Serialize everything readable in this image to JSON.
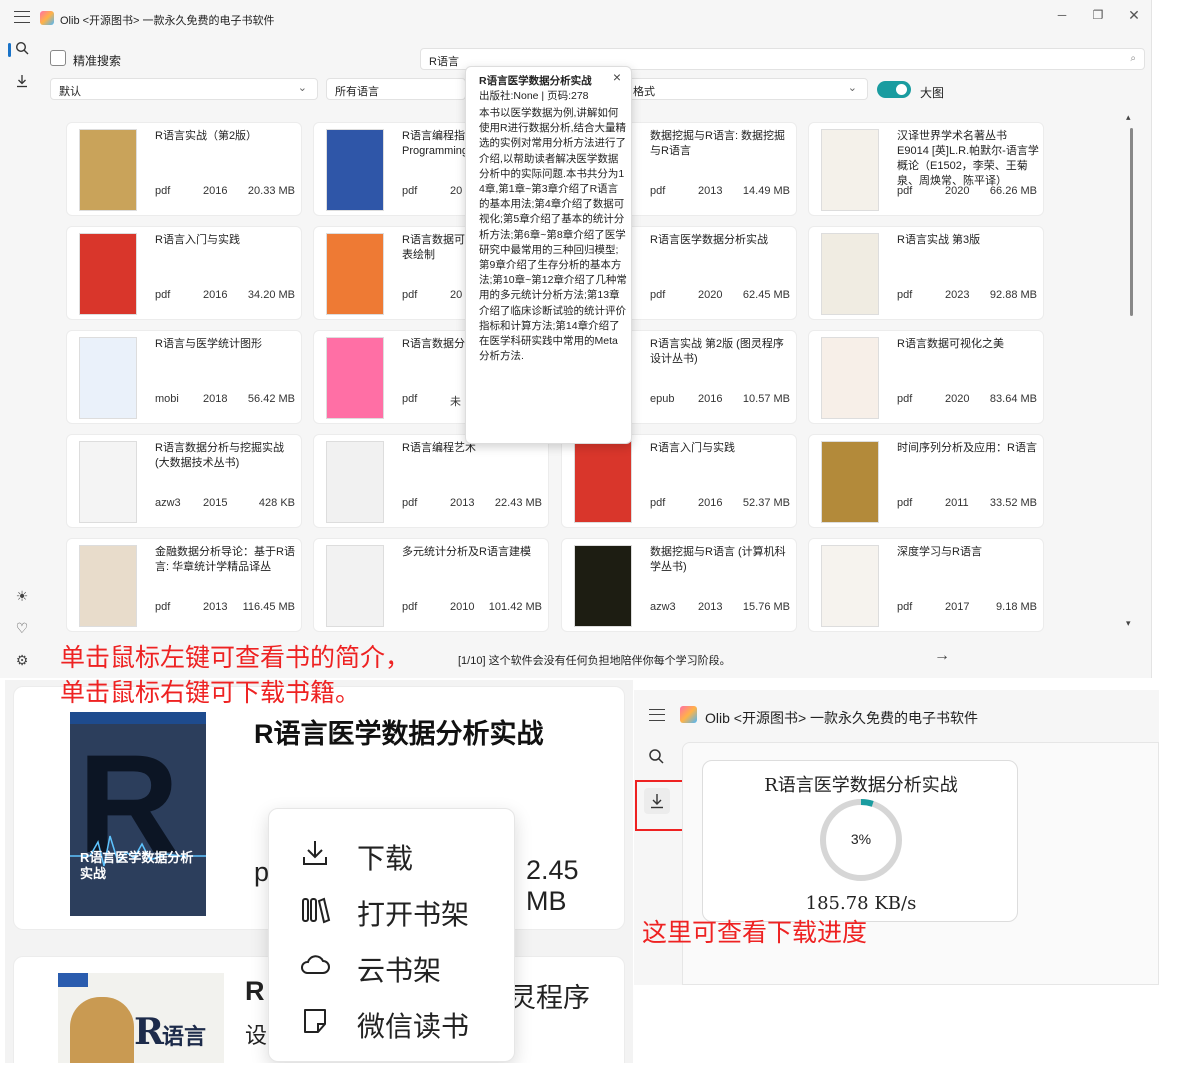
{
  "app": {
    "title": "Olib <开源图书> 一款永久免费的电子书软件",
    "window_controls": [
      "minimize",
      "maximize",
      "close"
    ]
  },
  "sidebar": {
    "top_icons": [
      "search-icon",
      "download-icon"
    ],
    "bottom_icons": [
      "theme-icon",
      "heart-icon",
      "settings-icon"
    ]
  },
  "search": {
    "exact_label": "精准搜索",
    "exact_checked": false,
    "query": "R语言"
  },
  "filters": {
    "sort": "默认",
    "language": "所有语言",
    "format": "格式",
    "large_image_label": "大图",
    "large_image_on": true
  },
  "books": [
    {
      "title": "R语言实战（第2版）",
      "format": "pdf",
      "year": "2016",
      "size": "20.33 MB",
      "cover": "#c9a35a"
    },
    {
      "title": "R语言编程指南 Programming",
      "format": "pdf",
      "year": "20",
      "size": "",
      "cover": "#2f56a8"
    },
    {
      "title": "",
      "format": "",
      "year": "",
      "size": "",
      "cover": "#ffffff"
    },
    {
      "title": "数据挖掘与R语言: 数据挖掘与R语言",
      "format": "pdf",
      "year": "2013",
      "size": "14.49 MB",
      "cover": "#ffffff"
    },
    {
      "title": "汉译世界学术名著丛书 E9014 [英]L.R.帕默尔-语言学概论（E1502，李荣、王菊泉、周焕常、陈平译）",
      "format": "pdf",
      "year": "2020",
      "size": "66.26 MB",
      "cover": "#f4f1ea"
    },
    {
      "title": "R语言入门与实践",
      "format": "pdf",
      "year": "2016",
      "size": "34.20 MB",
      "cover": "#d9362b"
    },
    {
      "title": "R语言数据可视化之美 业图表绘制",
      "format": "pdf",
      "year": "20",
      "size": "",
      "cover": "#ee7a34"
    },
    {
      "title": "",
      "format": "",
      "year": "",
      "size": "",
      "cover": "#ffffff"
    },
    {
      "title": "R语言医学数据分析实战",
      "format": "pdf",
      "year": "2020",
      "size": "62.45 MB",
      "cover": "#ffffff"
    },
    {
      "title": "R语言实战 第3版",
      "format": "pdf",
      "year": "2023",
      "size": "92.88 MB",
      "cover": "#f0ece2"
    },
    {
      "title": "R语言与医学统计图形",
      "format": "mobi",
      "year": "2018",
      "size": "56.42 MB",
      "cover": "#eaf1fa"
    },
    {
      "title": "R语言数据分",
      "format": "pdf",
      "year": "未",
      "size": "",
      "cover": "#ff6fa5"
    },
    {
      "title": "",
      "format": "",
      "year": "",
      "size": "",
      "cover": "#ffffff"
    },
    {
      "title": "R语言实战 第2版 (图灵程序设计丛书)",
      "format": "epub",
      "year": "2016",
      "size": "10.57 MB",
      "cover": "#ffffff"
    },
    {
      "title": "R语言数据可视化之美",
      "format": "pdf",
      "year": "2020",
      "size": "83.64 MB",
      "cover": "#f7efe8"
    },
    {
      "title": "R语言数据分析与挖掘实战 (大数据技术丛书)",
      "format": "azw3",
      "year": "2015",
      "size": "428 KB",
      "cover": "#f4f4f4"
    },
    {
      "title": "R语言编程艺术",
      "format": "pdf",
      "year": "2013",
      "size": "22.43 MB",
      "cover": "#f1f1f1"
    },
    {
      "title": "",
      "format": "",
      "year": "",
      "size": "",
      "cover": "#ffffff"
    },
    {
      "title": "R语言入门与实践",
      "format": "pdf",
      "year": "2016",
      "size": "52.37 MB",
      "cover": "#d9362b"
    },
    {
      "title": "时间序列分析及应用：R语言",
      "format": "pdf",
      "year": "2011",
      "size": "33.52 MB",
      "cover": "#b38a3a"
    },
    {
      "title": "金融数据分析导论：基于R语言: 华章统计学精品译丛",
      "format": "pdf",
      "year": "2013",
      "size": "116.45 MB",
      "cover": "#e8dccb"
    },
    {
      "title": "多元统计分析及R语言建模",
      "format": "pdf",
      "year": "2010",
      "size": "101.42 MB",
      "cover": "#f2f2f2"
    },
    {
      "title": "",
      "format": "",
      "year": "",
      "size": "",
      "cover": "#ffffff"
    },
    {
      "title": "数据挖掘与R语言 (计算机科学丛书)",
      "format": "azw3",
      "year": "2013",
      "size": "15.76 MB",
      "cover": "#1d1d12"
    },
    {
      "title": "深度学习与R语言",
      "format": "pdf",
      "year": "2017",
      "size": "9.18 MB",
      "cover": "#f6f3ee"
    }
  ],
  "hidden_col_partial": [
    {
      "format": "",
      "year": "",
      "size": ""
    }
  ],
  "popup": {
    "title": "R语言医学数据分析实战",
    "meta": "出版社:None | 页码:278",
    "description": "本书以医学数据为例,讲解如何使用R进行数据分析,结合大量精选的实例对常用分析方法进行了介绍,以帮助读者解决医学数据分析中的实际问题.本书共分为14章,第1章~第3章介绍了R语言的基本用法;第4章介绍了数据可视化;第5章介绍了基本的统计分析方法;第6章~第8章介绍了医学研究中最常用的三种回归模型;第9章介绍了生存分析的基本方法;第10章~第12章介绍了几种常用的多元统计分析方法;第13章介绍了临床诊断试验的统计评价指标和计算方法;第14章介绍了在医学科研实践中常用的Meta分析方法."
  },
  "status": {
    "text": "[1/10] 这个软件会没有任何负担地陪伴你每个学习阶段。"
  },
  "annotations": {
    "left_click": "单击鼠标左键可查看书的简介，",
    "right_click": "单击鼠标右键可下载书籍。",
    "progress_note": "这里可查看下载进度"
  },
  "zoom_left": {
    "book_title": "R语言医学数据分析实战",
    "format_partial": "p",
    "size_partial": "2.45 MB",
    "cover_title": "R语言医学数据分析实战",
    "second_title_partial": "R",
    "second_title_right": "灵程序",
    "second_line_partial": "设",
    "second_cover_text": "语言"
  },
  "context_menu": {
    "items": [
      {
        "label": "下载",
        "icon": "download-icon"
      },
      {
        "label": "打开书架",
        "icon": "bookshelf-icon"
      },
      {
        "label": "云书架",
        "icon": "cloud-icon"
      },
      {
        "label": "微信读书",
        "icon": "wechat-read-icon"
      }
    ]
  },
  "zoom_right": {
    "title": "Olib <开源图书> 一款永久免费的电子书软件",
    "download_title": "R语言医学数据分析实战",
    "progress_label": "3%",
    "progress_fraction": 0.03,
    "speed": "185.78 KB/s"
  },
  "colors": {
    "accent": "#1a9ca0",
    "annotation_red": "#e22222",
    "progress_track": "#d6d6d6"
  }
}
